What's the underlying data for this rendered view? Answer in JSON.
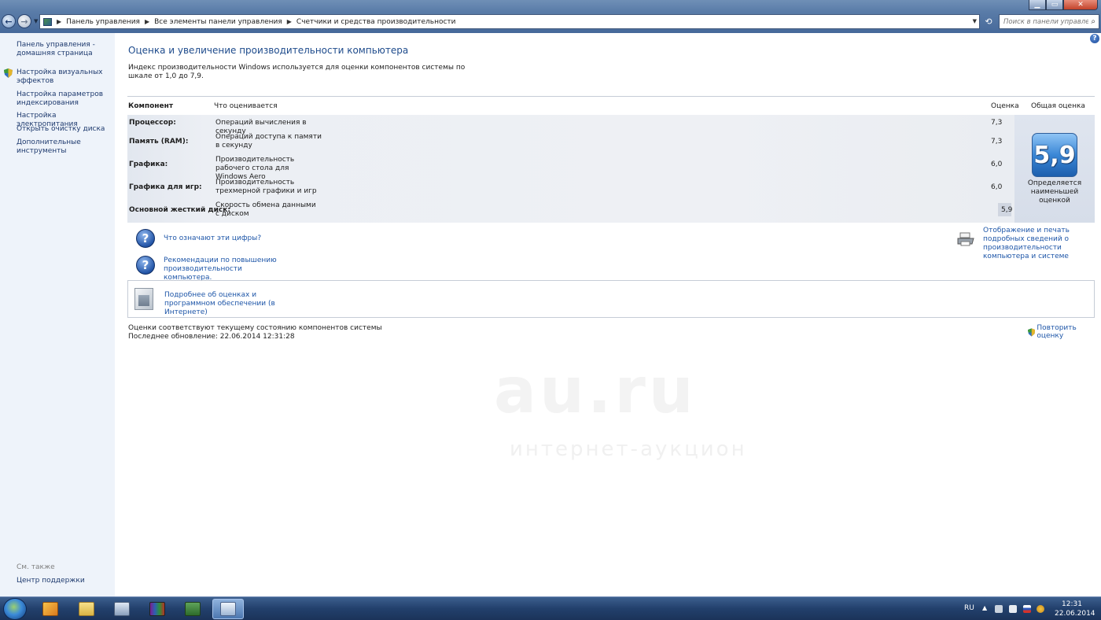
{
  "window": {
    "minimize_label": "▁",
    "maximize_label": "▭",
    "close_label": "✕"
  },
  "address": {
    "crumbs": [
      "Панель управления",
      "Все элементы панели управления",
      "Счетчики и средства производительности"
    ]
  },
  "search": {
    "placeholder": "Поиск в панели управления"
  },
  "sidebar": {
    "items": [
      {
        "label": "Панель управления - домашняя страница"
      },
      {
        "label": "Настройка визуальных эффектов"
      },
      {
        "label": "Настройка параметров индексирования"
      },
      {
        "label": "Настройка электропитания"
      },
      {
        "label": "Открыть очистку диска"
      },
      {
        "label": "Дополнительные инструменты"
      }
    ],
    "see_also": "См. также",
    "support": "Центр поддержки"
  },
  "main": {
    "title": "Оценка и увеличение производительности компьютера",
    "intro": "Индекс производительности Windows используется для оценки компонентов системы по шкале от 1,0 до 7,9.",
    "table": {
      "headers": {
        "component": "Компонент",
        "rated": "Что оценивается",
        "score": "Оценка",
        "overall": "Общая оценка"
      },
      "rows": [
        {
          "component": "Процессор:",
          "description": "Операций вычисления в секунду",
          "score": "7,3"
        },
        {
          "component": "Память (RAM):",
          "description": "Операций доступа к памяти в секунду",
          "score": "7,3"
        },
        {
          "component": "Графика:",
          "description": "Производительность рабочего стола для Windows Aero",
          "score": "6,0"
        },
        {
          "component": "Графика для игр:",
          "description": "Производительность трехмерной графики и игр",
          "score": "6,0"
        },
        {
          "component": "Основной жесткий диск:",
          "description": "Скорость обмена данными с диском",
          "score": "5,9"
        }
      ],
      "overall_score": "5,9",
      "overall_caption": "Определяется наименьшей оценкой"
    },
    "links": {
      "what_numbers": "Что означают эти цифры?",
      "recommendations": "Рекомендации по повышению производительности компьютера.",
      "print_details": "Отображение и печать подробных сведений о производительности компьютера и системе",
      "more_info": "Подробнее об оценках и программном обеспечении (в Интернете)"
    },
    "status": {
      "line1": "Оценки соответствуют текущему состоянию компонентов системы",
      "line2": "Последнее обновление: 22.06.2014 12:31:28"
    },
    "rerun": "Повторить оценку"
  },
  "watermark": {
    "brand": "au.ru",
    "tagline": "интернет-аукцион"
  },
  "taskbar": {
    "lang": "RU",
    "time": "12:31",
    "date": "22.06.2014"
  },
  "colors": {
    "link": "#1e56a8",
    "title": "#1e4b8c",
    "badge": "#3a87d6"
  }
}
